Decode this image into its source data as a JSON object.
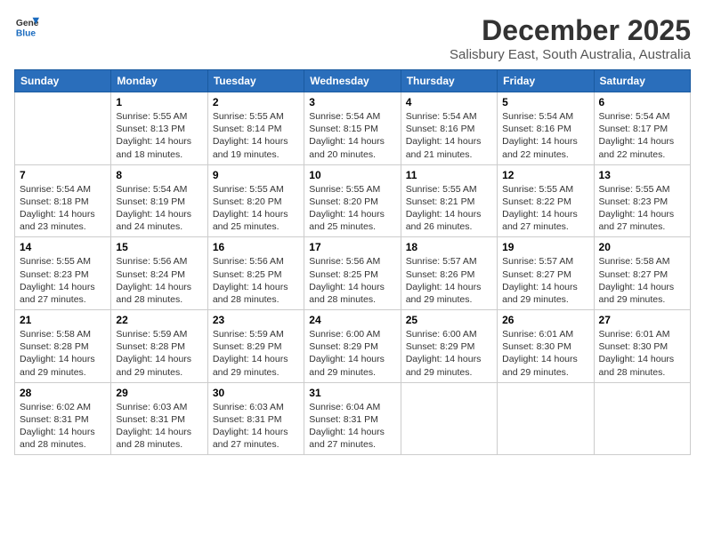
{
  "logo": {
    "line1": "General",
    "line2": "Blue"
  },
  "title": "December 2025",
  "location": "Salisbury East, South Australia, Australia",
  "days_of_week": [
    "Sunday",
    "Monday",
    "Tuesday",
    "Wednesday",
    "Thursday",
    "Friday",
    "Saturday"
  ],
  "weeks": [
    [
      {
        "day": "",
        "info": ""
      },
      {
        "day": "1",
        "info": "Sunrise: 5:55 AM\nSunset: 8:13 PM\nDaylight: 14 hours\nand 18 minutes."
      },
      {
        "day": "2",
        "info": "Sunrise: 5:55 AM\nSunset: 8:14 PM\nDaylight: 14 hours\nand 19 minutes."
      },
      {
        "day": "3",
        "info": "Sunrise: 5:54 AM\nSunset: 8:15 PM\nDaylight: 14 hours\nand 20 minutes."
      },
      {
        "day": "4",
        "info": "Sunrise: 5:54 AM\nSunset: 8:16 PM\nDaylight: 14 hours\nand 21 minutes."
      },
      {
        "day": "5",
        "info": "Sunrise: 5:54 AM\nSunset: 8:16 PM\nDaylight: 14 hours\nand 22 minutes."
      },
      {
        "day": "6",
        "info": "Sunrise: 5:54 AM\nSunset: 8:17 PM\nDaylight: 14 hours\nand 22 minutes."
      }
    ],
    [
      {
        "day": "7",
        "info": "Sunrise: 5:54 AM\nSunset: 8:18 PM\nDaylight: 14 hours\nand 23 minutes."
      },
      {
        "day": "8",
        "info": "Sunrise: 5:54 AM\nSunset: 8:19 PM\nDaylight: 14 hours\nand 24 minutes."
      },
      {
        "day": "9",
        "info": "Sunrise: 5:55 AM\nSunset: 8:20 PM\nDaylight: 14 hours\nand 25 minutes."
      },
      {
        "day": "10",
        "info": "Sunrise: 5:55 AM\nSunset: 8:20 PM\nDaylight: 14 hours\nand 25 minutes."
      },
      {
        "day": "11",
        "info": "Sunrise: 5:55 AM\nSunset: 8:21 PM\nDaylight: 14 hours\nand 26 minutes."
      },
      {
        "day": "12",
        "info": "Sunrise: 5:55 AM\nSunset: 8:22 PM\nDaylight: 14 hours\nand 27 minutes."
      },
      {
        "day": "13",
        "info": "Sunrise: 5:55 AM\nSunset: 8:23 PM\nDaylight: 14 hours\nand 27 minutes."
      }
    ],
    [
      {
        "day": "14",
        "info": "Sunrise: 5:55 AM\nSunset: 8:23 PM\nDaylight: 14 hours\nand 27 minutes."
      },
      {
        "day": "15",
        "info": "Sunrise: 5:56 AM\nSunset: 8:24 PM\nDaylight: 14 hours\nand 28 minutes."
      },
      {
        "day": "16",
        "info": "Sunrise: 5:56 AM\nSunset: 8:25 PM\nDaylight: 14 hours\nand 28 minutes."
      },
      {
        "day": "17",
        "info": "Sunrise: 5:56 AM\nSunset: 8:25 PM\nDaylight: 14 hours\nand 28 minutes."
      },
      {
        "day": "18",
        "info": "Sunrise: 5:57 AM\nSunset: 8:26 PM\nDaylight: 14 hours\nand 29 minutes."
      },
      {
        "day": "19",
        "info": "Sunrise: 5:57 AM\nSunset: 8:27 PM\nDaylight: 14 hours\nand 29 minutes."
      },
      {
        "day": "20",
        "info": "Sunrise: 5:58 AM\nSunset: 8:27 PM\nDaylight: 14 hours\nand 29 minutes."
      }
    ],
    [
      {
        "day": "21",
        "info": "Sunrise: 5:58 AM\nSunset: 8:28 PM\nDaylight: 14 hours\nand 29 minutes."
      },
      {
        "day": "22",
        "info": "Sunrise: 5:59 AM\nSunset: 8:28 PM\nDaylight: 14 hours\nand 29 minutes."
      },
      {
        "day": "23",
        "info": "Sunrise: 5:59 AM\nSunset: 8:29 PM\nDaylight: 14 hours\nand 29 minutes."
      },
      {
        "day": "24",
        "info": "Sunrise: 6:00 AM\nSunset: 8:29 PM\nDaylight: 14 hours\nand 29 minutes."
      },
      {
        "day": "25",
        "info": "Sunrise: 6:00 AM\nSunset: 8:29 PM\nDaylight: 14 hours\nand 29 minutes."
      },
      {
        "day": "26",
        "info": "Sunrise: 6:01 AM\nSunset: 8:30 PM\nDaylight: 14 hours\nand 29 minutes."
      },
      {
        "day": "27",
        "info": "Sunrise: 6:01 AM\nSunset: 8:30 PM\nDaylight: 14 hours\nand 28 minutes."
      }
    ],
    [
      {
        "day": "28",
        "info": "Sunrise: 6:02 AM\nSunset: 8:31 PM\nDaylight: 14 hours\nand 28 minutes."
      },
      {
        "day": "29",
        "info": "Sunrise: 6:03 AM\nSunset: 8:31 PM\nDaylight: 14 hours\nand 28 minutes."
      },
      {
        "day": "30",
        "info": "Sunrise: 6:03 AM\nSunset: 8:31 PM\nDaylight: 14 hours\nand 27 minutes."
      },
      {
        "day": "31",
        "info": "Sunrise: 6:04 AM\nSunset: 8:31 PM\nDaylight: 14 hours\nand 27 minutes."
      },
      {
        "day": "",
        "info": ""
      },
      {
        "day": "",
        "info": ""
      },
      {
        "day": "",
        "info": ""
      }
    ]
  ]
}
